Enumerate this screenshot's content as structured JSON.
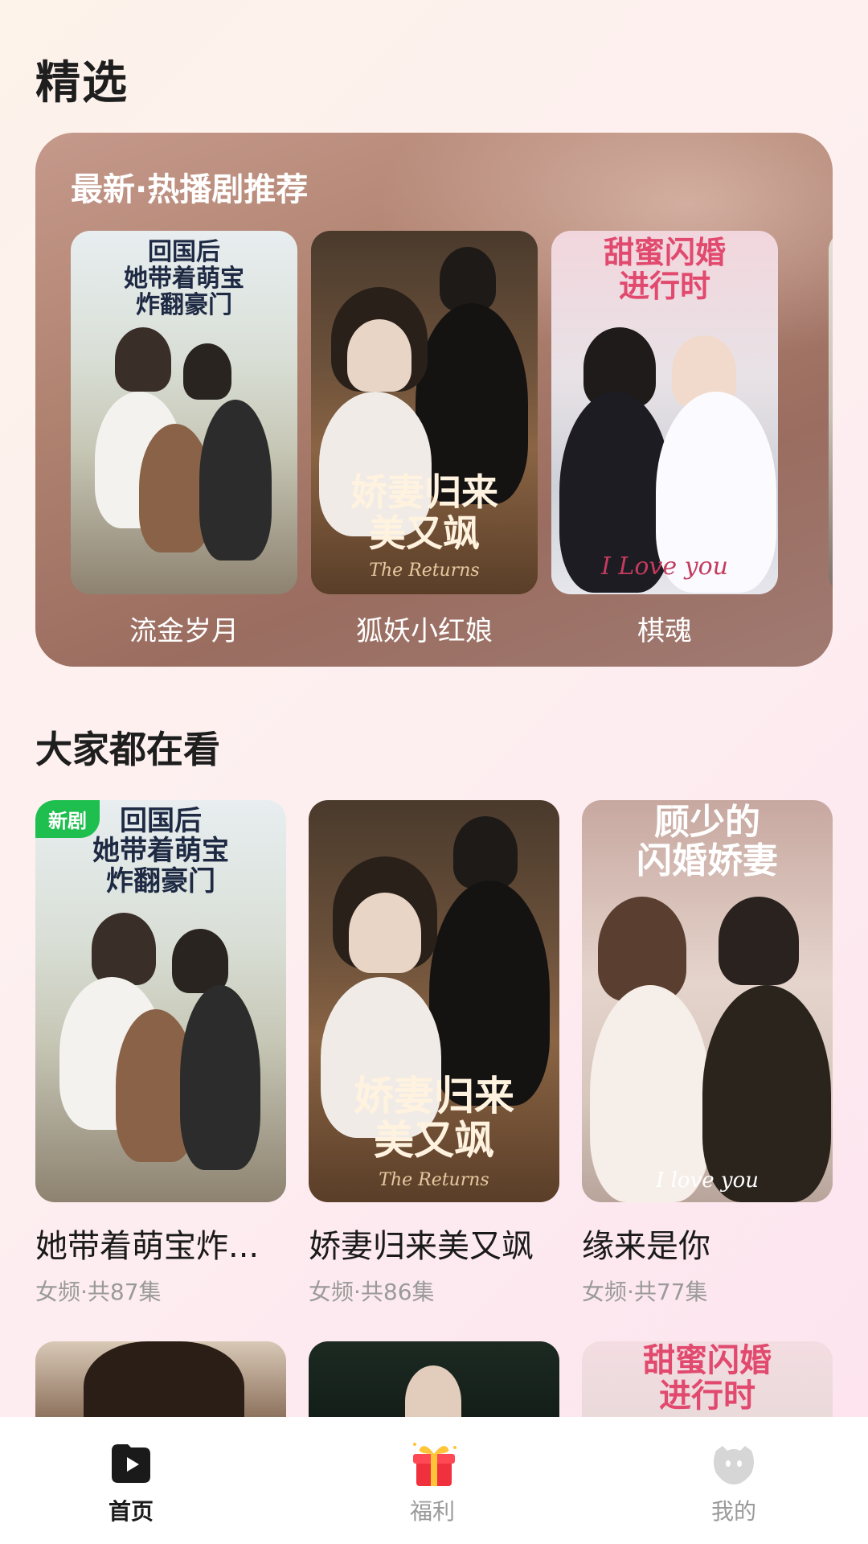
{
  "header": {
    "title": "精选"
  },
  "featured": {
    "title": "最新·热播剧推荐",
    "items": [
      {
        "label": "流金岁月",
        "poster_text": "回国后\n她带着萌宝\n炸翻豪门"
      },
      {
        "label": "狐妖小红娘",
        "poster_text": "娇妻归来\n美又飒",
        "poster_sub": "The Returns"
      },
      {
        "label": "棋魂",
        "poster_text": "甜蜜闪婚\n进行时",
        "poster_sub": "I Love you"
      }
    ]
  },
  "popular": {
    "title": "大家都在看",
    "items": [
      {
        "title": "她带着萌宝炸...",
        "meta": "女频·共87集",
        "badge": "新剧",
        "poster_text": "回国后\n她带着萌宝\n炸翻豪门"
      },
      {
        "title": "娇妻归来美又飒",
        "meta": "女频·共86集",
        "poster_text": "娇妻归来\n美又飒",
        "poster_sub": "The Returns"
      },
      {
        "title": "缘来是你",
        "meta": "女频·共77集",
        "poster_text": "顾少的\n闪婚娇妻",
        "poster_sub": "I love you"
      }
    ],
    "next_row_texts": [
      "",
      "",
      "甜蜜闪婚\n进行时"
    ]
  },
  "nav": {
    "items": [
      {
        "label": "首页",
        "icon": "play-icon",
        "active": true
      },
      {
        "label": "福利",
        "icon": "gift-icon",
        "active": false
      },
      {
        "label": "我的",
        "icon": "profile-icon",
        "active": false
      }
    ]
  },
  "colors": {
    "badge": "#1fbf4f",
    "active_nav": "#1a1a1a",
    "inactive_nav": "#9a9a9a"
  }
}
